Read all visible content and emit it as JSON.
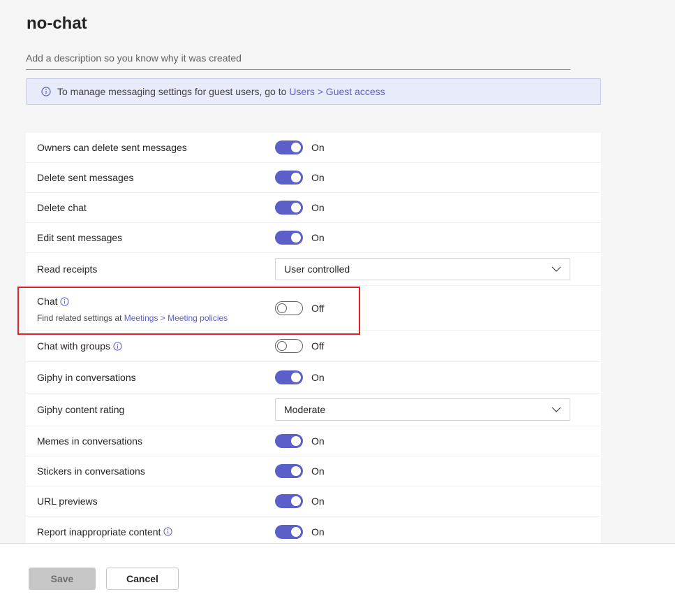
{
  "page": {
    "title": "no-chat",
    "description_placeholder": "Add a description so you know why it was created",
    "description_value": ""
  },
  "banner": {
    "text": "To manage messaging settings for guest users, go to",
    "link": "Users > Guest access"
  },
  "settings": [
    {
      "label": "Owners can delete sent messages",
      "type": "toggle",
      "state": "On"
    },
    {
      "label": "Delete sent messages",
      "type": "toggle",
      "state": "On"
    },
    {
      "label": "Delete chat",
      "type": "toggle",
      "state": "On"
    },
    {
      "label": "Edit sent messages",
      "type": "toggle",
      "state": "On"
    },
    {
      "label": "Read receipts",
      "type": "dropdown",
      "value": "User controlled"
    },
    {
      "label": "Chat",
      "type": "toggle",
      "state": "Off",
      "sub_text": "Find related settings at",
      "sub_link": "Meetings > Meeting policies",
      "has_info": true
    },
    {
      "label": "Chat with groups",
      "type": "toggle",
      "state": "Off",
      "has_info": true
    },
    {
      "label": "Giphy in conversations",
      "type": "toggle",
      "state": "On"
    },
    {
      "label": "Giphy content rating",
      "type": "dropdown",
      "value": "Moderate"
    },
    {
      "label": "Memes in conversations",
      "type": "toggle",
      "state": "On"
    },
    {
      "label": "Stickers in conversations",
      "type": "toggle",
      "state": "On"
    },
    {
      "label": "URL previews",
      "type": "toggle",
      "state": "On"
    },
    {
      "label": "Report inappropriate content",
      "type": "toggle",
      "state": "On",
      "has_info": true
    }
  ],
  "footer": {
    "save_label": "Save",
    "cancel_label": "Cancel"
  },
  "colors": {
    "accent": "#5b5fc7",
    "highlight": "#e0202a",
    "banner_bg": "#e8ebfa"
  }
}
